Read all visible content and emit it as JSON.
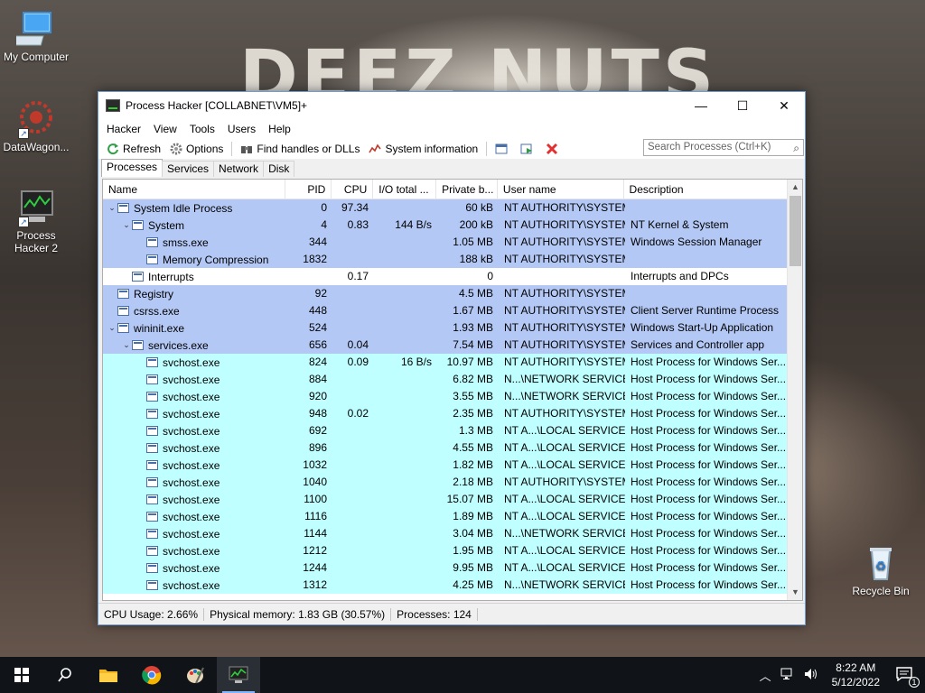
{
  "desktop": {
    "bg_text": "DEEZ NUTS",
    "icons": [
      {
        "label": "My Computer"
      },
      {
        "label": "DataWagon..."
      },
      {
        "label": "Process Hacker 2"
      },
      {
        "label": "Recycle Bin"
      }
    ]
  },
  "window": {
    "title": "Process Hacker [COLLABNET\\VM5]+",
    "menu": [
      "Hacker",
      "View",
      "Tools",
      "Users",
      "Help"
    ],
    "toolbar": {
      "refresh": "Refresh",
      "options": "Options",
      "find_handles": "Find handles or DLLs",
      "system_info": "System information"
    },
    "search_placeholder": "Search Processes (Ctrl+K)",
    "tabs": [
      "Processes",
      "Services",
      "Network",
      "Disk"
    ],
    "columns": [
      "Name",
      "PID",
      "CPU",
      "I/O total ...",
      "Private b...",
      "User name",
      "Description"
    ],
    "rows": [
      {
        "depth": 0,
        "toggle": "v",
        "name": "System Idle Process",
        "pid": "0",
        "cpu": "97.34",
        "io": "",
        "priv": "60 kB",
        "user": "NT AUTHORITY\\SYSTEM",
        "desc": "",
        "color": "blue"
      },
      {
        "depth": 1,
        "toggle": "v",
        "name": "System",
        "pid": "4",
        "cpu": "0.83",
        "io": "144 B/s",
        "priv": "200 kB",
        "user": "NT AUTHORITY\\SYSTEM",
        "desc": "NT Kernel & System",
        "color": "blue"
      },
      {
        "depth": 2,
        "toggle": "",
        "name": "smss.exe",
        "pid": "344",
        "cpu": "",
        "io": "",
        "priv": "1.05 MB",
        "user": "NT AUTHORITY\\SYSTEM",
        "desc": "Windows Session Manager",
        "color": "blue"
      },
      {
        "depth": 2,
        "toggle": "",
        "name": "Memory Compression",
        "pid": "1832",
        "cpu": "",
        "io": "",
        "priv": "188 kB",
        "user": "NT AUTHORITY\\SYSTEM",
        "desc": "",
        "color": "blue"
      },
      {
        "depth": 1,
        "toggle": "",
        "name": "Interrupts",
        "pid": "",
        "cpu": "0.17",
        "io": "",
        "priv": "0",
        "user": "",
        "desc": "Interrupts and DPCs",
        "color": "white"
      },
      {
        "depth": 0,
        "toggle": "",
        "name": "Registry",
        "pid": "92",
        "cpu": "",
        "io": "",
        "priv": "4.5 MB",
        "user": "NT AUTHORITY\\SYSTEM",
        "desc": "",
        "color": "blue"
      },
      {
        "depth": 0,
        "toggle": "",
        "name": "csrss.exe",
        "pid": "448",
        "cpu": "",
        "io": "",
        "priv": "1.67 MB",
        "user": "NT AUTHORITY\\SYSTEM",
        "desc": "Client Server Runtime Process",
        "color": "blue"
      },
      {
        "depth": 0,
        "toggle": "v",
        "name": "wininit.exe",
        "pid": "524",
        "cpu": "",
        "io": "",
        "priv": "1.93 MB",
        "user": "NT AUTHORITY\\SYSTEM",
        "desc": "Windows Start-Up Application",
        "color": "blue"
      },
      {
        "depth": 1,
        "toggle": "v",
        "name": "services.exe",
        "pid": "656",
        "cpu": "0.04",
        "io": "",
        "priv": "7.54 MB",
        "user": "NT AUTHORITY\\SYSTEM",
        "desc": "Services and Controller app",
        "color": "blue"
      },
      {
        "depth": 2,
        "toggle": "",
        "name": "svchost.exe",
        "pid": "824",
        "cpu": "0.09",
        "io": "16 B/s",
        "priv": "10.97 MB",
        "user": "NT AUTHORITY\\SYSTEM",
        "desc": "Host Process for Windows Ser...",
        "color": "cyan"
      },
      {
        "depth": 2,
        "toggle": "",
        "name": "svchost.exe",
        "pid": "884",
        "cpu": "",
        "io": "",
        "priv": "6.82 MB",
        "user": "N...\\NETWORK SERVICE",
        "desc": "Host Process for Windows Ser...",
        "color": "cyan"
      },
      {
        "depth": 2,
        "toggle": "",
        "name": "svchost.exe",
        "pid": "920",
        "cpu": "",
        "io": "",
        "priv": "3.55 MB",
        "user": "N...\\NETWORK SERVICE",
        "desc": "Host Process for Windows Ser...",
        "color": "cyan"
      },
      {
        "depth": 2,
        "toggle": "",
        "name": "svchost.exe",
        "pid": "948",
        "cpu": "0.02",
        "io": "",
        "priv": "2.35 MB",
        "user": "NT AUTHORITY\\SYSTEM",
        "desc": "Host Process for Windows Ser...",
        "color": "cyan"
      },
      {
        "depth": 2,
        "toggle": "",
        "name": "svchost.exe",
        "pid": "692",
        "cpu": "",
        "io": "",
        "priv": "1.3 MB",
        "user": "NT A...\\LOCAL SERVICE",
        "desc": "Host Process for Windows Ser...",
        "color": "cyan"
      },
      {
        "depth": 2,
        "toggle": "",
        "name": "svchost.exe",
        "pid": "896",
        "cpu": "",
        "io": "",
        "priv": "4.55 MB",
        "user": "NT A...\\LOCAL SERVICE",
        "desc": "Host Process for Windows Ser...",
        "color": "cyan"
      },
      {
        "depth": 2,
        "toggle": "",
        "name": "svchost.exe",
        "pid": "1032",
        "cpu": "",
        "io": "",
        "priv": "1.82 MB",
        "user": "NT A...\\LOCAL SERVICE",
        "desc": "Host Process for Windows Ser...",
        "color": "cyan"
      },
      {
        "depth": 2,
        "toggle": "",
        "name": "svchost.exe",
        "pid": "1040",
        "cpu": "",
        "io": "",
        "priv": "2.18 MB",
        "user": "NT AUTHORITY\\SYSTEM",
        "desc": "Host Process for Windows Ser...",
        "color": "cyan"
      },
      {
        "depth": 2,
        "toggle": "",
        "name": "svchost.exe",
        "pid": "1100",
        "cpu": "",
        "io": "",
        "priv": "15.07 MB",
        "user": "NT A...\\LOCAL SERVICE",
        "desc": "Host Process for Windows Ser...",
        "color": "cyan"
      },
      {
        "depth": 2,
        "toggle": "",
        "name": "svchost.exe",
        "pid": "1116",
        "cpu": "",
        "io": "",
        "priv": "1.89 MB",
        "user": "NT A...\\LOCAL SERVICE",
        "desc": "Host Process for Windows Ser...",
        "color": "cyan"
      },
      {
        "depth": 2,
        "toggle": "",
        "name": "svchost.exe",
        "pid": "1144",
        "cpu": "",
        "io": "",
        "priv": "3.04 MB",
        "user": "N...\\NETWORK SERVICE",
        "desc": "Host Process for Windows Ser...",
        "color": "cyan"
      },
      {
        "depth": 2,
        "toggle": "",
        "name": "svchost.exe",
        "pid": "1212",
        "cpu": "",
        "io": "",
        "priv": "1.95 MB",
        "user": "NT A...\\LOCAL SERVICE",
        "desc": "Host Process for Windows Ser...",
        "color": "cyan"
      },
      {
        "depth": 2,
        "toggle": "",
        "name": "svchost.exe",
        "pid": "1244",
        "cpu": "",
        "io": "",
        "priv": "9.95 MB",
        "user": "NT A...\\LOCAL SERVICE",
        "desc": "Host Process for Windows Ser...",
        "color": "cyan"
      },
      {
        "depth": 2,
        "toggle": "",
        "name": "svchost.exe",
        "pid": "1312",
        "cpu": "",
        "io": "",
        "priv": "4.25 MB",
        "user": "N...\\NETWORK SERVICE",
        "desc": "Host Process for Windows Ser...",
        "color": "cyan"
      }
    ],
    "status": {
      "cpu": "CPU Usage: 2.66%",
      "memory": "Physical memory: 1.83 GB (30.57%)",
      "processes": "Processes: 124"
    }
  },
  "taskbar": {
    "time": "8:22 AM",
    "date": "5/12/2022",
    "notification_count": "1"
  },
  "colors": {
    "system_process": "#b4c8f5",
    "service_process": "#c0ffff",
    "taskbar": "#101418"
  }
}
